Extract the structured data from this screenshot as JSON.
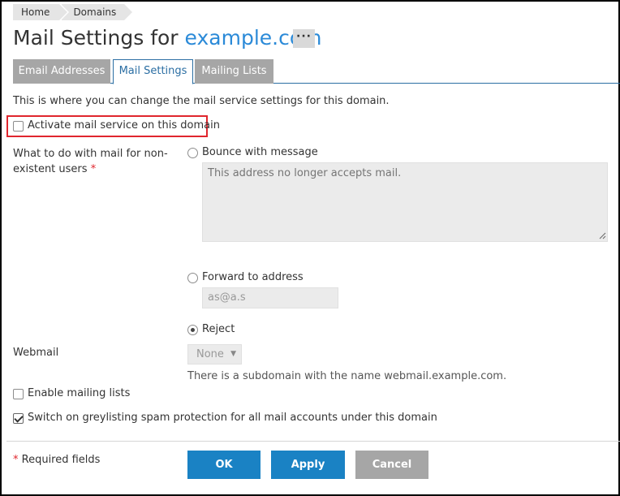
{
  "breadcrumb": {
    "items": [
      "Home",
      "Domains"
    ]
  },
  "page": {
    "title_prefix": "Mail Settings for ",
    "title_domain": "example.com",
    "more_label": "···"
  },
  "tabs": [
    {
      "label": "Email Addresses",
      "active": false
    },
    {
      "label": "Mail Settings",
      "active": true
    },
    {
      "label": "Mailing Lists",
      "active": false
    }
  ],
  "form": {
    "description": "This is where you can change the mail service settings for this domain.",
    "activate_mail": {
      "label": "Activate mail service on this domain",
      "checked": false
    },
    "nonexistent_users": {
      "label": "What to do with mail for non-existent users",
      "required_mark": "*",
      "options": {
        "bounce": {
          "label": "Bounce with message",
          "checked": false,
          "message_placeholder": "This address no longer accepts mail."
        },
        "forward": {
          "label": "Forward to address",
          "checked": false,
          "address_value": "as@a.s"
        },
        "reject": {
          "label": "Reject",
          "checked": true
        }
      }
    },
    "webmail": {
      "label": "Webmail",
      "selected": "None",
      "hint": "There is a subdomain with the name webmail.example.com."
    },
    "enable_mailing_lists": {
      "label": "Enable mailing lists",
      "checked": false
    },
    "greylisting": {
      "label": "Switch on greylisting spam protection for all mail accounts under this domain",
      "checked": true
    },
    "required_note_mark": "*",
    "required_note": " Required fields"
  },
  "buttons": {
    "ok": "OK",
    "apply": "Apply",
    "cancel": "Cancel"
  },
  "colors": {
    "accent": "#1a82c4",
    "link": "#2b8ad8",
    "highlight_border": "#e0262e",
    "tab_inactive": "#a6a6a6"
  }
}
